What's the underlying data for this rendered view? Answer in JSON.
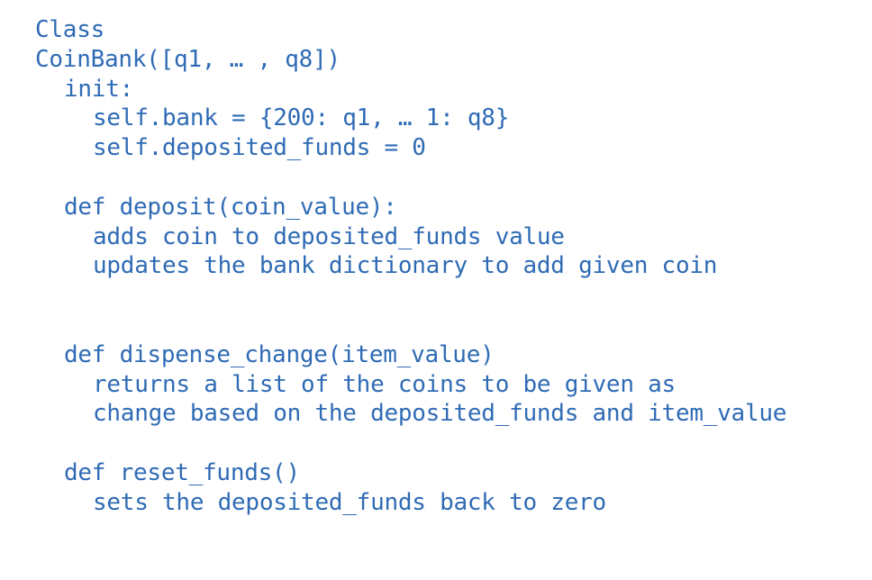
{
  "lines": {
    "l1": "Class",
    "l2": "CoinBank([q1, … , q8])",
    "l3": "init:",
    "l4": "self.bank = {200: q1, … 1: q8}",
    "l5": "self.deposited_funds = 0",
    "l6": "def deposit(coin_value):",
    "l7": "adds coin to deposited_funds value",
    "l8": "updates the bank dictionary to add given coin",
    "l9": "def dispense_change(item_value)",
    "l10": "returns a list of the coins to be given as",
    "l11": "change based on the deposited_funds and item_value",
    "l12": "def reset_funds()",
    "l13": "sets the deposited_funds back to zero"
  },
  "colors": {
    "text": "#2f6bb5",
    "background": "#ffffff"
  }
}
